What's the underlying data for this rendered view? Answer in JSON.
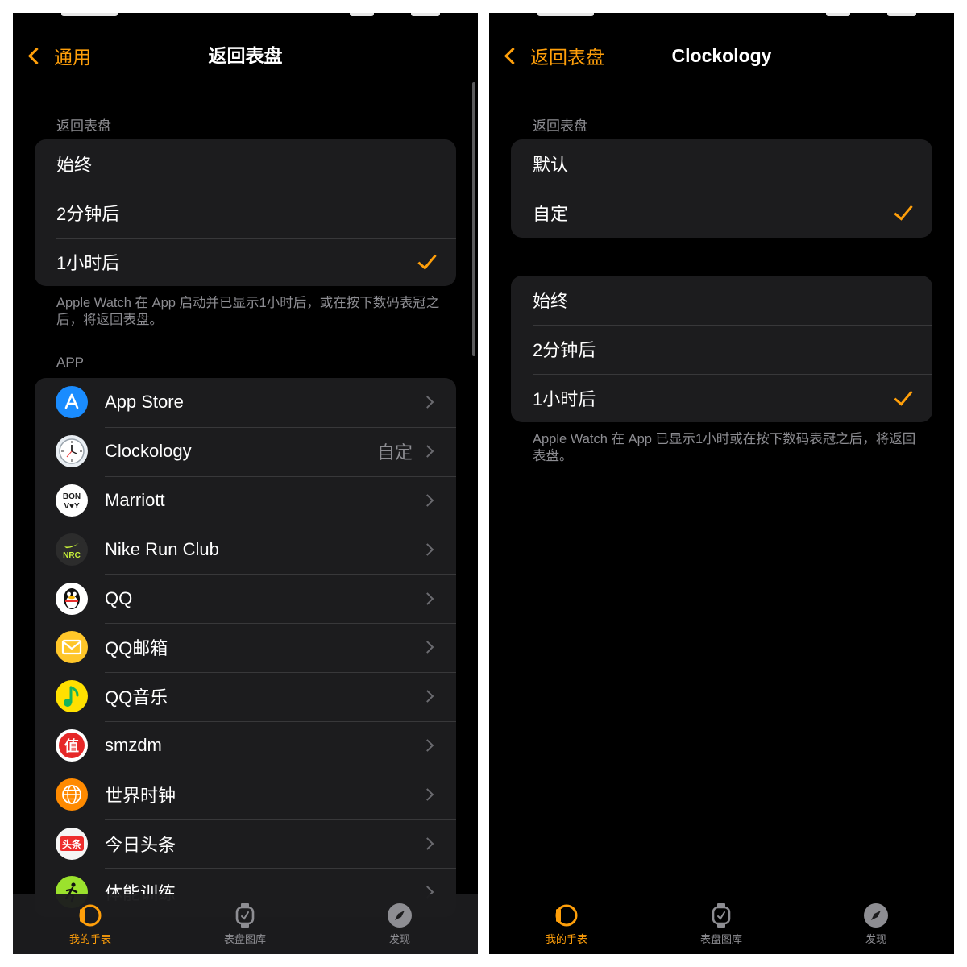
{
  "colors": {
    "accent": "#ff9f0a",
    "background": "#000000",
    "group": "#1c1c1e",
    "secondary_text": "#8d8d92"
  },
  "left": {
    "nav": {
      "back_label": "通用",
      "title": "返回表盘"
    },
    "section_header": "返回表盘",
    "options": [
      {
        "label": "始终",
        "checked": false
      },
      {
        "label": "2分钟后",
        "checked": false
      },
      {
        "label": "1小时后",
        "checked": true
      }
    ],
    "footer": "Apple Watch 在 App 启动并已显示1小时后，或在按下数码表冠之后，将返回表盘。",
    "apps_header": "APP",
    "apps": [
      {
        "name": "App Store",
        "value": "",
        "icon": "app-store-icon"
      },
      {
        "name": "Clockology",
        "value": "自定",
        "icon": "clockology-icon"
      },
      {
        "name": "Marriott",
        "value": "",
        "icon": "marriott-bonvoy-icon"
      },
      {
        "name": "Nike Run Club",
        "value": "",
        "icon": "nike-run-club-icon"
      },
      {
        "name": "QQ",
        "value": "",
        "icon": "qq-penguin-icon"
      },
      {
        "name": "QQ邮箱",
        "value": "",
        "icon": "qq-mail-icon"
      },
      {
        "name": "QQ音乐",
        "value": "",
        "icon": "qq-music-icon"
      },
      {
        "name": "smzdm",
        "value": "",
        "icon": "smzdm-icon"
      },
      {
        "name": "世界时钟",
        "value": "",
        "icon": "world-clock-globe-icon"
      },
      {
        "name": "今日头条",
        "value": "",
        "icon": "toutiao-icon"
      },
      {
        "name": "体能训练",
        "value": "",
        "icon": "workout-runner-icon"
      }
    ]
  },
  "right": {
    "nav": {
      "back_label": "返回表盘",
      "title": "Clockology"
    },
    "section_header": "返回表盘",
    "mode_options": [
      {
        "label": "默认",
        "checked": false
      },
      {
        "label": "自定",
        "checked": true
      }
    ],
    "options": [
      {
        "label": "始终",
        "checked": false
      },
      {
        "label": "2分钟后",
        "checked": false
      },
      {
        "label": "1小时后",
        "checked": true
      }
    ],
    "footer": "Apple Watch 在 App 已显示1小时或在按下数码表冠之后，将返回表盘。"
  },
  "tabs": [
    {
      "label": "我的手表",
      "icon": "my-watch-icon",
      "active": true
    },
    {
      "label": "表盘图库",
      "icon": "face-gallery-icon",
      "active": false
    },
    {
      "label": "发现",
      "icon": "discover-compass-icon",
      "active": false
    }
  ]
}
